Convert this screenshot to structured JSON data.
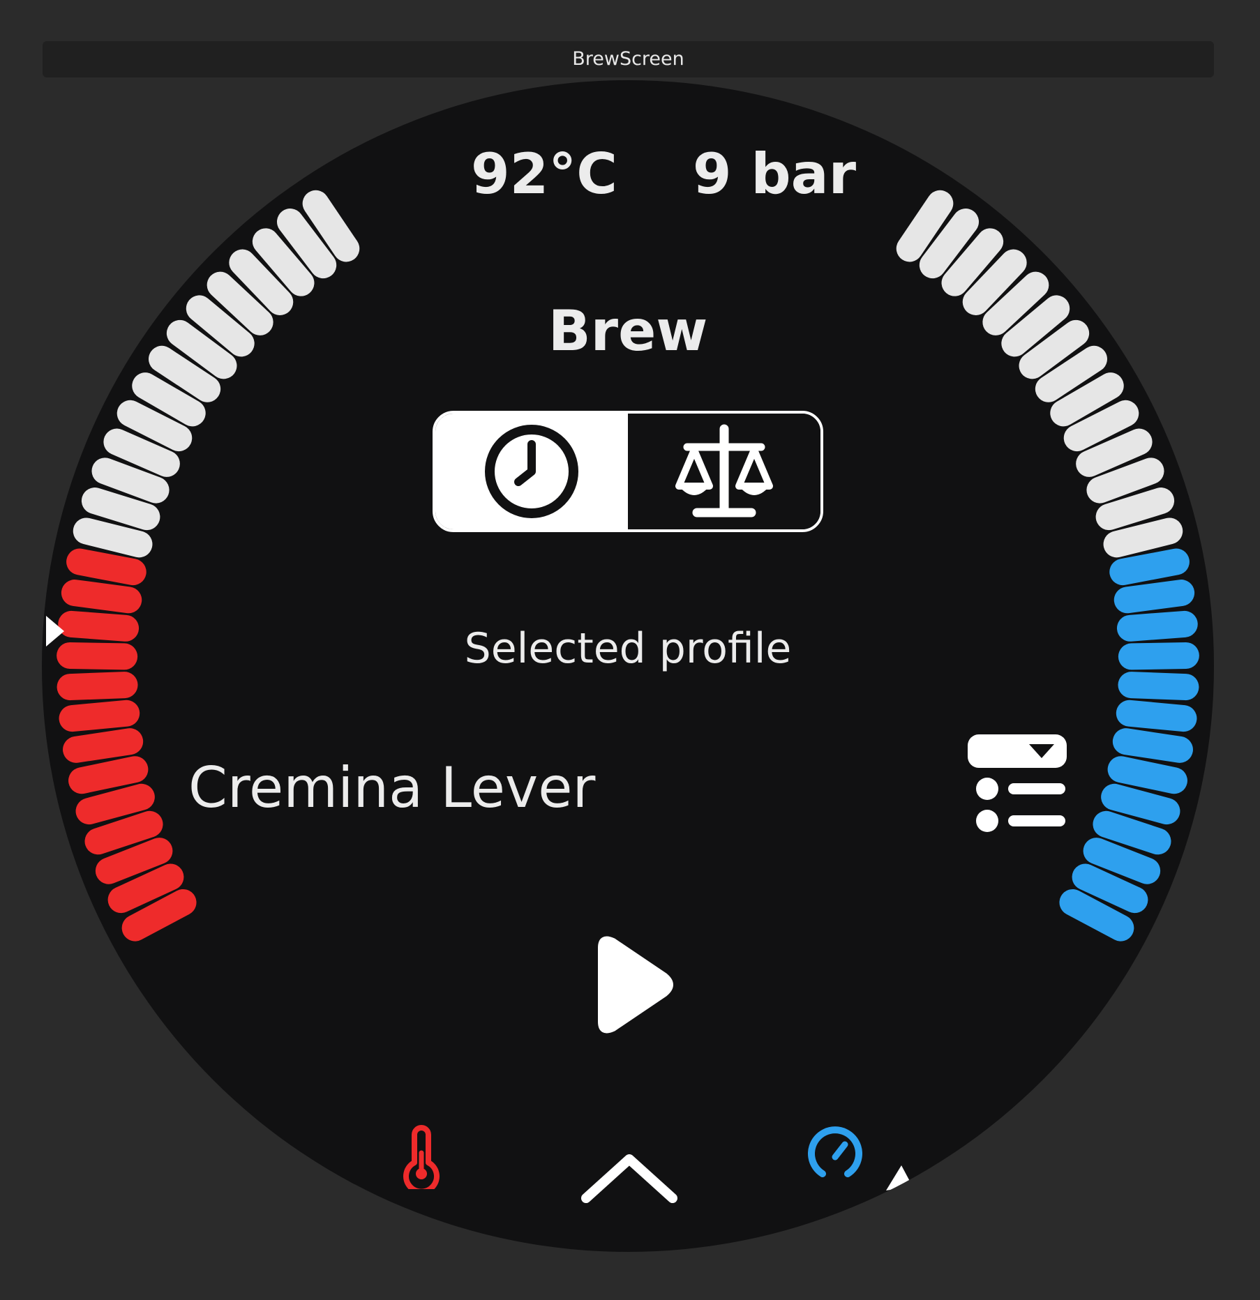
{
  "window": {
    "title": "BrewScreen"
  },
  "readouts": {
    "temperature": "92°C",
    "pressure": "9 bar"
  },
  "screen": {
    "title": "Brew"
  },
  "mode_toggle": {
    "options": [
      {
        "name": "time",
        "icon": "clock-icon",
        "selected": true
      },
      {
        "name": "weight",
        "icon": "scale-icon",
        "selected": false
      }
    ]
  },
  "profile": {
    "caption": "Selected profile",
    "name": "Cremina Lever"
  },
  "temperature_gauge": {
    "fill_fraction": 0.48,
    "color": "#ee2b2b",
    "icon": "thermometer-icon"
  },
  "pressure_gauge": {
    "fill_fraction": 0.48,
    "color": "#2ea0ee",
    "icon": "gauge-icon"
  },
  "colors": {
    "background": "#111112",
    "tick_inactive": "#e6e6e6",
    "temperature": "#ee2b2b",
    "pressure": "#2ea0ee",
    "foreground": "#ffffff"
  },
  "icons": {
    "start": "play-icon",
    "profile_list": "profile-list-icon",
    "swipe_up": "chevron-up-icon"
  }
}
